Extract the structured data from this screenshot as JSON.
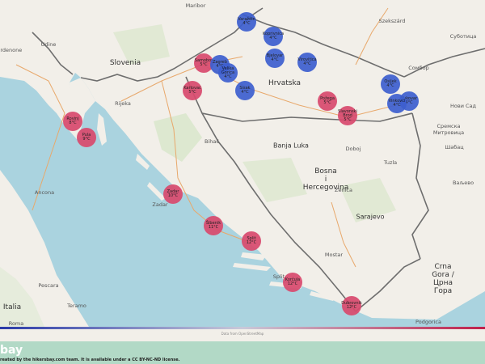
{
  "places": [
    {
      "id": "maribor",
      "label": "Maribor",
      "cls": ""
    },
    {
      "id": "slovenia",
      "label": "Slovenia",
      "cls": "country"
    },
    {
      "id": "rijeka",
      "label": "Rijeka",
      "cls": ""
    },
    {
      "id": "hrvatska",
      "label": "Hrvatska",
      "cls": "country"
    },
    {
      "id": "banja-luka",
      "label": "Banja Luka",
      "cls": "big"
    },
    {
      "id": "bosna",
      "label": "Bosna\ni\nHercegovina",
      "cls": "country"
    },
    {
      "id": "zenica",
      "label": "Zenica",
      "cls": ""
    },
    {
      "id": "sarajevo",
      "label": "Sarajevo",
      "cls": "big"
    },
    {
      "id": "mostar",
      "label": "Mostar",
      "cls": ""
    },
    {
      "id": "split-lbl",
      "label": "Split",
      "cls": ""
    },
    {
      "id": "italia",
      "label": "Italia",
      "cls": "country"
    },
    {
      "id": "roma",
      "label": "Roma",
      "cls": ""
    },
    {
      "id": "ancona",
      "label": "Ancona",
      "cls": ""
    },
    {
      "id": "pescara",
      "label": "Pescara",
      "cls": ""
    },
    {
      "id": "teramo",
      "label": "Teramo",
      "cls": ""
    },
    {
      "id": "crna-gora",
      "label": "Crna\nGora /\nЦрна\nГора",
      "cls": "country"
    },
    {
      "id": "podgorica",
      "label": "Podgorica",
      "cls": ""
    },
    {
      "id": "szekszard",
      "label": "Szekszárd",
      "cls": ""
    },
    {
      "id": "subotica",
      "label": "Суботица",
      "cls": ""
    },
    {
      "id": "sombor",
      "label": "Сомбор",
      "cls": ""
    },
    {
      "id": "novi-sad",
      "label": "Нови Сад",
      "cls": ""
    },
    {
      "id": "sremska",
      "label": "Сремска\nМитровица",
      "cls": ""
    },
    {
      "id": "sabac",
      "label": "Шабац",
      "cls": ""
    },
    {
      "id": "valjevo",
      "label": "Ваљево",
      "cls": ""
    },
    {
      "id": "udine",
      "label": "Udine",
      "cls": ""
    },
    {
      "id": "pordenone",
      "label": "Pordenone",
      "cls": ""
    },
    {
      "id": "bihac",
      "label": "Bihać",
      "cls": ""
    },
    {
      "id": "tuzla",
      "label": "Tuzla",
      "cls": ""
    },
    {
      "id": "doboj",
      "label": "Doboj",
      "cls": ""
    },
    {
      "id": "zadar-lbl",
      "label": "Zadar",
      "cls": ""
    }
  ],
  "weather_markers": [
    {
      "id": "varazdin",
      "name": "Varaždin",
      "temp": "4°C",
      "type": "cold"
    },
    {
      "id": "koprivnica",
      "name": "Koprivnica",
      "temp": "4°C",
      "type": "cold"
    },
    {
      "id": "samobor",
      "name": "Samobor",
      "temp": "5°C",
      "type": "warm"
    },
    {
      "id": "zagreb",
      "name": "Zagreb",
      "temp": "4°C",
      "type": "cold"
    },
    {
      "id": "velika",
      "name": "Velika Gorica",
      "temp": "4°C",
      "type": "cold"
    },
    {
      "id": "bjelovar",
      "name": "Bjelovar",
      "temp": "4°C",
      "type": "cold"
    },
    {
      "id": "virovitica",
      "name": "Virovitica",
      "temp": "4°C",
      "type": "cold"
    },
    {
      "id": "osijek",
      "name": "Osijek",
      "temp": "4°C",
      "type": "cold"
    },
    {
      "id": "vukovar",
      "name": "Vukovar",
      "temp": "4°C",
      "type": "cold"
    },
    {
      "id": "vinkovci",
      "name": "Vinkovci",
      "temp": "4°C",
      "type": "cold"
    },
    {
      "id": "karlovac",
      "name": "Karlovac",
      "temp": "5°C",
      "type": "warm"
    },
    {
      "id": "sisak",
      "name": "Sisak",
      "temp": "4°C",
      "type": "cold"
    },
    {
      "id": "pozega",
      "name": "Požega",
      "temp": "5°C",
      "type": "warm"
    },
    {
      "id": "slavonski",
      "name": "Slavonski Brod",
      "temp": "5°C",
      "type": "warm"
    },
    {
      "id": "rovinj",
      "name": "Rovinj",
      "temp": "8°C",
      "type": "warm"
    },
    {
      "id": "pula",
      "name": "Pula",
      "temp": "9°C",
      "type": "warm"
    },
    {
      "id": "zadar",
      "name": "Zadar",
      "temp": "10°C",
      "type": "warm"
    },
    {
      "id": "sibenik",
      "name": "Šibenik",
      "temp": "11°C",
      "type": "warm"
    },
    {
      "id": "split",
      "name": "Split",
      "temp": "12°C",
      "type": "warm"
    },
    {
      "id": "korcula",
      "name": "Korčula",
      "temp": "12°C",
      "type": "warm"
    },
    {
      "id": "dubrovnik",
      "name": "Dubrovnik",
      "temp": "12°C",
      "type": "warm"
    }
  ],
  "colors": {
    "sea": "#aad3df",
    "land": "#f2efe9",
    "cold_marker": "#3d5fcf",
    "warm_marker": "#d94a6e",
    "footer": "#b2d9c6"
  },
  "attribution": "Data from OpenStreetMap",
  "footer": {
    "brand": "bay",
    "credit": "reated by the hikersbay.com team. It is available under a CC BY-NC-ND license."
  }
}
